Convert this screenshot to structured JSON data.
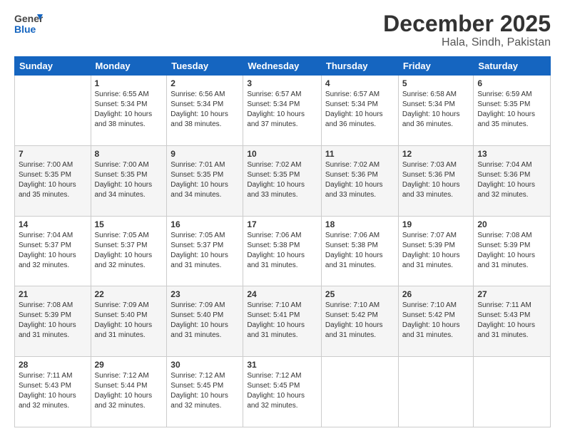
{
  "header": {
    "logo_general": "General",
    "logo_blue": "Blue",
    "title": "December 2025",
    "subtitle": "Hala, Sindh, Pakistan"
  },
  "weekdays": [
    "Sunday",
    "Monday",
    "Tuesday",
    "Wednesday",
    "Thursday",
    "Friday",
    "Saturday"
  ],
  "weeks": [
    [
      {
        "day": "",
        "info": ""
      },
      {
        "day": "1",
        "info": "Sunrise: 6:55 AM\nSunset: 5:34 PM\nDaylight: 10 hours\nand 38 minutes."
      },
      {
        "day": "2",
        "info": "Sunrise: 6:56 AM\nSunset: 5:34 PM\nDaylight: 10 hours\nand 38 minutes."
      },
      {
        "day": "3",
        "info": "Sunrise: 6:57 AM\nSunset: 5:34 PM\nDaylight: 10 hours\nand 37 minutes."
      },
      {
        "day": "4",
        "info": "Sunrise: 6:57 AM\nSunset: 5:34 PM\nDaylight: 10 hours\nand 36 minutes."
      },
      {
        "day": "5",
        "info": "Sunrise: 6:58 AM\nSunset: 5:34 PM\nDaylight: 10 hours\nand 36 minutes."
      },
      {
        "day": "6",
        "info": "Sunrise: 6:59 AM\nSunset: 5:35 PM\nDaylight: 10 hours\nand 35 minutes."
      }
    ],
    [
      {
        "day": "7",
        "info": "Sunrise: 7:00 AM\nSunset: 5:35 PM\nDaylight: 10 hours\nand 35 minutes."
      },
      {
        "day": "8",
        "info": "Sunrise: 7:00 AM\nSunset: 5:35 PM\nDaylight: 10 hours\nand 34 minutes."
      },
      {
        "day": "9",
        "info": "Sunrise: 7:01 AM\nSunset: 5:35 PM\nDaylight: 10 hours\nand 34 minutes."
      },
      {
        "day": "10",
        "info": "Sunrise: 7:02 AM\nSunset: 5:35 PM\nDaylight: 10 hours\nand 33 minutes."
      },
      {
        "day": "11",
        "info": "Sunrise: 7:02 AM\nSunset: 5:36 PM\nDaylight: 10 hours\nand 33 minutes."
      },
      {
        "day": "12",
        "info": "Sunrise: 7:03 AM\nSunset: 5:36 PM\nDaylight: 10 hours\nand 33 minutes."
      },
      {
        "day": "13",
        "info": "Sunrise: 7:04 AM\nSunset: 5:36 PM\nDaylight: 10 hours\nand 32 minutes."
      }
    ],
    [
      {
        "day": "14",
        "info": "Sunrise: 7:04 AM\nSunset: 5:37 PM\nDaylight: 10 hours\nand 32 minutes."
      },
      {
        "day": "15",
        "info": "Sunrise: 7:05 AM\nSunset: 5:37 PM\nDaylight: 10 hours\nand 32 minutes."
      },
      {
        "day": "16",
        "info": "Sunrise: 7:05 AM\nSunset: 5:37 PM\nDaylight: 10 hours\nand 31 minutes."
      },
      {
        "day": "17",
        "info": "Sunrise: 7:06 AM\nSunset: 5:38 PM\nDaylight: 10 hours\nand 31 minutes."
      },
      {
        "day": "18",
        "info": "Sunrise: 7:06 AM\nSunset: 5:38 PM\nDaylight: 10 hours\nand 31 minutes."
      },
      {
        "day": "19",
        "info": "Sunrise: 7:07 AM\nSunset: 5:39 PM\nDaylight: 10 hours\nand 31 minutes."
      },
      {
        "day": "20",
        "info": "Sunrise: 7:08 AM\nSunset: 5:39 PM\nDaylight: 10 hours\nand 31 minutes."
      }
    ],
    [
      {
        "day": "21",
        "info": "Sunrise: 7:08 AM\nSunset: 5:39 PM\nDaylight: 10 hours\nand 31 minutes."
      },
      {
        "day": "22",
        "info": "Sunrise: 7:09 AM\nSunset: 5:40 PM\nDaylight: 10 hours\nand 31 minutes."
      },
      {
        "day": "23",
        "info": "Sunrise: 7:09 AM\nSunset: 5:40 PM\nDaylight: 10 hours\nand 31 minutes."
      },
      {
        "day": "24",
        "info": "Sunrise: 7:10 AM\nSunset: 5:41 PM\nDaylight: 10 hours\nand 31 minutes."
      },
      {
        "day": "25",
        "info": "Sunrise: 7:10 AM\nSunset: 5:42 PM\nDaylight: 10 hours\nand 31 minutes."
      },
      {
        "day": "26",
        "info": "Sunrise: 7:10 AM\nSunset: 5:42 PM\nDaylight: 10 hours\nand 31 minutes."
      },
      {
        "day": "27",
        "info": "Sunrise: 7:11 AM\nSunset: 5:43 PM\nDaylight: 10 hours\nand 31 minutes."
      }
    ],
    [
      {
        "day": "28",
        "info": "Sunrise: 7:11 AM\nSunset: 5:43 PM\nDaylight: 10 hours\nand 32 minutes."
      },
      {
        "day": "29",
        "info": "Sunrise: 7:12 AM\nSunset: 5:44 PM\nDaylight: 10 hours\nand 32 minutes."
      },
      {
        "day": "30",
        "info": "Sunrise: 7:12 AM\nSunset: 5:45 PM\nDaylight: 10 hours\nand 32 minutes."
      },
      {
        "day": "31",
        "info": "Sunrise: 7:12 AM\nSunset: 5:45 PM\nDaylight: 10 hours\nand 32 minutes."
      },
      {
        "day": "",
        "info": ""
      },
      {
        "day": "",
        "info": ""
      },
      {
        "day": "",
        "info": ""
      }
    ]
  ]
}
